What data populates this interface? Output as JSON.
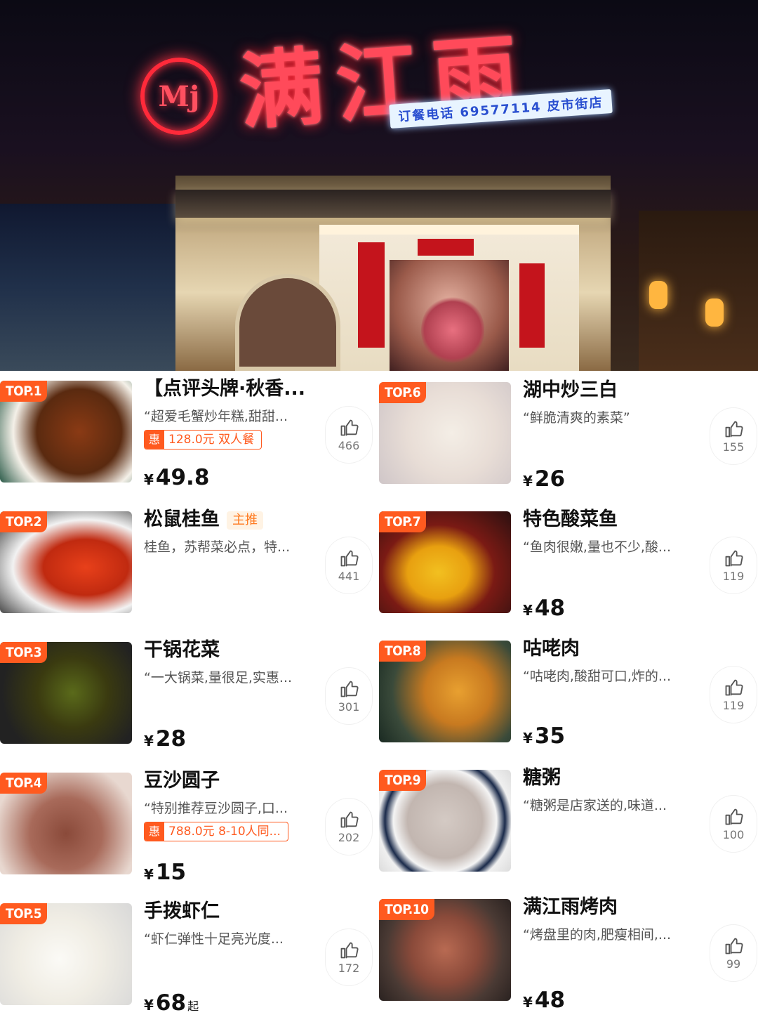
{
  "banner": {
    "logo_text": "Mj",
    "sign_name": "满江雨",
    "sign_phone": "订餐电话 69577114 皮市街店"
  },
  "colors": {
    "accent": "#ff5a1f",
    "deal_border": "#ff5a1f",
    "tag_text": "#ff7a20"
  },
  "dishes": [
    {
      "rank": "TOP.1",
      "name": "【点评头牌·秋香...",
      "tag": "",
      "quote": "“超爱毛蟹炒年糕,甜甜...",
      "deal": {
        "icon": "惠",
        "text": "128.0元 双人餐"
      },
      "price": "49.8",
      "price_suffix": "",
      "likes": "466",
      "currency": "¥"
    },
    {
      "rank": "TOP.2",
      "name": "松鼠桂鱼",
      "tag": "主推",
      "quote": "桂鱼，苏帮菜必点，特...",
      "deal": null,
      "price": "",
      "price_suffix": "",
      "likes": "441",
      "currency": "¥"
    },
    {
      "rank": "TOP.3",
      "name": "干锅花菜",
      "tag": "",
      "quote": "“一大锅菜,量很足,实惠...",
      "deal": null,
      "price": "28",
      "price_suffix": "",
      "likes": "301",
      "currency": "¥"
    },
    {
      "rank": "TOP.4",
      "name": "豆沙圆子",
      "tag": "",
      "quote": "“特别推荐豆沙圆子,口...",
      "deal": {
        "icon": "惠",
        "text": "788.0元 8-10人同..."
      },
      "price": "15",
      "price_suffix": "",
      "likes": "202",
      "currency": "¥"
    },
    {
      "rank": "TOP.5",
      "name": "手拨虾仁",
      "tag": "",
      "quote": "“虾仁弹性十足亮光度...",
      "deal": null,
      "price": "68",
      "price_suffix": "起",
      "likes": "172",
      "currency": "¥"
    },
    {
      "rank": "TOP.6",
      "name": "湖中炒三白",
      "tag": "",
      "quote": "“鲜脆清爽的素菜”",
      "deal": null,
      "price": "26",
      "price_suffix": "",
      "likes": "155",
      "currency": "¥"
    },
    {
      "rank": "TOP.7",
      "name": "特色酸菜鱼",
      "tag": "",
      "quote": "“鱼肉很嫩,量也不少,酸...",
      "deal": null,
      "price": "48",
      "price_suffix": "",
      "likes": "119",
      "currency": "¥"
    },
    {
      "rank": "TOP.8",
      "name": "咕咾肉",
      "tag": "",
      "quote": "“咕咾肉,酸甜可口,炸的...",
      "deal": null,
      "price": "35",
      "price_suffix": "",
      "likes": "119",
      "currency": "¥"
    },
    {
      "rank": "TOP.9",
      "name": "糖粥",
      "tag": "",
      "quote": "“糖粥是店家送的,味道...",
      "deal": null,
      "price": "",
      "price_suffix": "",
      "likes": "100",
      "currency": "¥"
    },
    {
      "rank": "TOP.10",
      "name": "满江雨烤肉",
      "tag": "",
      "quote": "“烤盘里的肉,肥瘦相间,...",
      "deal": null,
      "price": "48",
      "price_suffix": "",
      "likes": "99",
      "currency": "¥"
    }
  ]
}
